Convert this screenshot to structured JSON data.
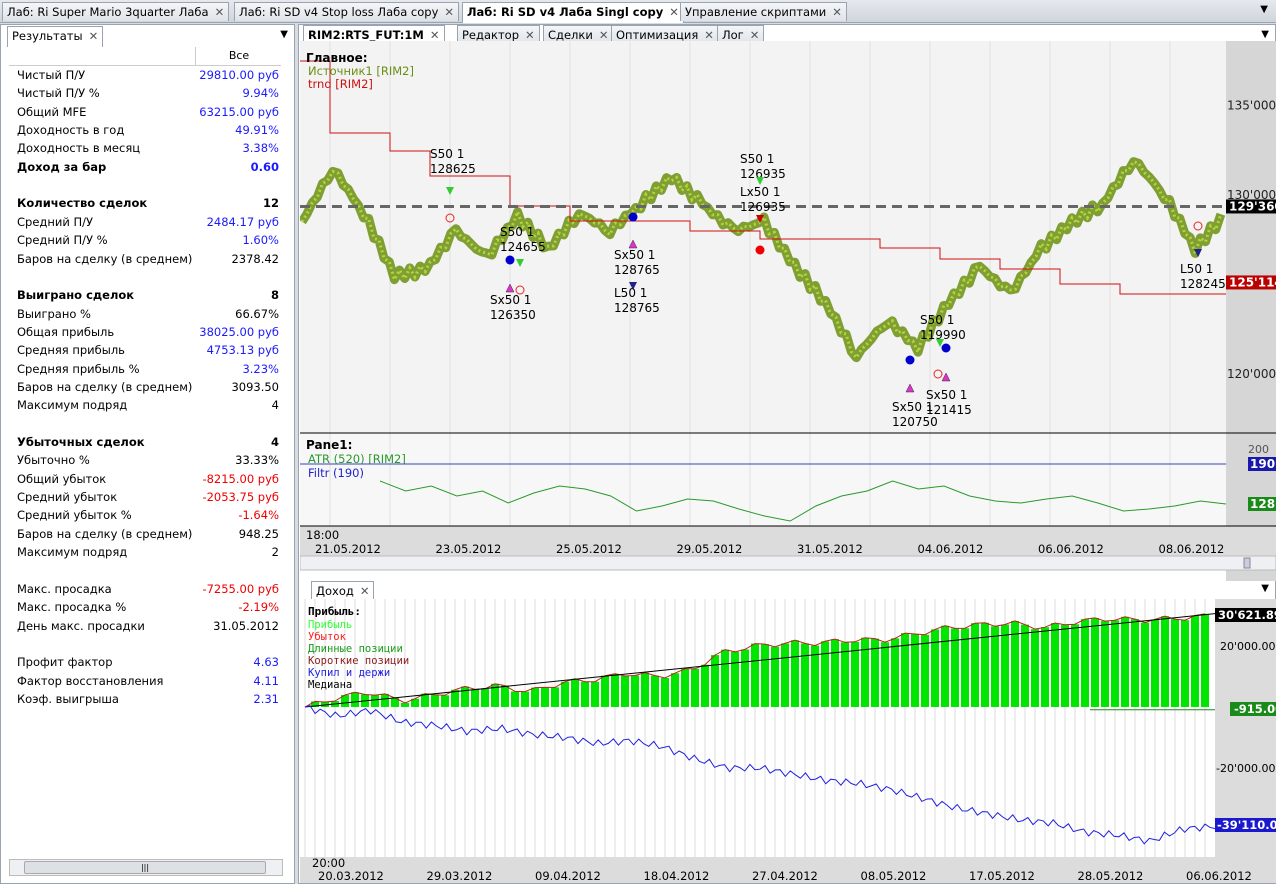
{
  "top_tabs": [
    {
      "label": "Лаб: Ri Super Mario 3quarter Лаба"
    },
    {
      "label": "Лаб: Ri SD v4 Stop loss Лаба copy"
    },
    {
      "label": "Лаб: Ri SD v4 Лаба Singl copy",
      "active": true
    },
    {
      "label": "Управление скриптами"
    }
  ],
  "left_panel": {
    "tab": "Результаты",
    "column_header": "Все",
    "rows": [
      {
        "label": "Чистый П/У",
        "value": "29810.00 руб",
        "color": "blue"
      },
      {
        "label": "Чистый П/У %",
        "value": "9.94%",
        "color": "blue"
      },
      {
        "label": "Общий MFE",
        "value": "63215.00 руб",
        "color": "blue"
      },
      {
        "label": "Доходность в год",
        "value": "49.91%",
        "color": "blue"
      },
      {
        "label": "Доходность в месяц",
        "value": "3.38%",
        "color": "blue"
      },
      {
        "label": "Доход за бар",
        "value": "0.60",
        "color": "blue",
        "bold": true
      },
      {
        "label": "",
        "value": ""
      },
      {
        "label": "Количество сделок",
        "value": "12",
        "color": "black",
        "bold": true
      },
      {
        "label": "Средний П/У",
        "value": "2484.17 руб",
        "color": "blue"
      },
      {
        "label": "Средний П/У %",
        "value": "1.60%",
        "color": "blue"
      },
      {
        "label": "Баров на сделку (в среднем)",
        "value": "2378.42",
        "color": "black"
      },
      {
        "label": "",
        "value": ""
      },
      {
        "label": "Выиграно сделок",
        "value": "8",
        "color": "black",
        "bold": true
      },
      {
        "label": "Выиграно %",
        "value": "66.67%",
        "color": "black"
      },
      {
        "label": "Общая прибыль",
        "value": "38025.00 руб",
        "color": "blue"
      },
      {
        "label": "Средняя прибыль",
        "value": "4753.13 руб",
        "color": "blue"
      },
      {
        "label": "Средняя прибыль %",
        "value": "3.23%",
        "color": "blue"
      },
      {
        "label": "Баров на сделку (в среднем)",
        "value": "3093.50",
        "color": "black"
      },
      {
        "label": "Максимум подряд",
        "value": "4",
        "color": "black"
      },
      {
        "label": "",
        "value": ""
      },
      {
        "label": "Убыточных сделок",
        "value": "4",
        "color": "black",
        "bold": true
      },
      {
        "label": "Убыточно %",
        "value": "33.33%",
        "color": "black"
      },
      {
        "label": "Общий убыток",
        "value": "-8215.00 руб",
        "color": "red"
      },
      {
        "label": "Средний убыток",
        "value": "-2053.75 руб",
        "color": "red"
      },
      {
        "label": "Средний убыток %",
        "value": "-1.64%",
        "color": "red"
      },
      {
        "label": "Баров на сделку (в среднем)",
        "value": "948.25",
        "color": "black"
      },
      {
        "label": "Максимум подряд",
        "value": "2",
        "color": "black"
      },
      {
        "label": "",
        "value": ""
      },
      {
        "label": "Макс. просадка",
        "value": "-7255.00 руб",
        "color": "red"
      },
      {
        "label": "Макс. просадка %",
        "value": "-2.19%",
        "color": "red"
      },
      {
        "label": "День макс. просадки",
        "value": "31.05.2012",
        "color": "black"
      },
      {
        "label": "",
        "value": ""
      },
      {
        "label": "Профит фактор",
        "value": "4.63",
        "color": "blue"
      },
      {
        "label": "Фактор восстановления",
        "value": "4.11",
        "color": "blue"
      },
      {
        "label": "Коэф. выигрыша",
        "value": "2.31",
        "color": "blue"
      }
    ]
  },
  "right_tabs": [
    {
      "label": "RIM2:RTS_FUT:1M",
      "active": true
    },
    {
      "label": "Редактор"
    },
    {
      "label": "Сделки"
    },
    {
      "label": "Оптимизация"
    },
    {
      "label": "Лог"
    }
  ],
  "main_chart": {
    "title": "Главное:",
    "legend": [
      "Источник1 [RIM2]",
      "trnd [RIM2]"
    ],
    "y_ticks": [
      "135'000",
      "130'000",
      "120'000"
    ],
    "last_price": "129'360",
    "trnd_last": "125'114",
    "pane1": {
      "title": "Pane1:",
      "legend": [
        "ATR (520) [RIM2]",
        "Filtr (190)"
      ],
      "tick": "200",
      "filtr_label": "190",
      "atr_label": "128"
    },
    "time_label": "18:00",
    "dates": [
      "21.05.2012",
      "23.05.2012",
      "25.05.2012",
      "29.05.2012",
      "31.05.2012",
      "04.06.2012",
      "06.06.2012",
      "08.06.2012"
    ],
    "signals": [
      {
        "l1": "S50 1",
        "l2": "128625"
      },
      {
        "l1": "S50 1",
        "l2": "124655"
      },
      {
        "l1": "Sx50 1",
        "l2": "126350"
      },
      {
        "l1": "Sx50 1",
        "l2": "128765"
      },
      {
        "l1": "L50 1",
        "l2": "128765"
      },
      {
        "l1": "S50 1",
        "l2": "126935"
      },
      {
        "l1": "Lx50 1",
        "l2": "126935"
      },
      {
        "l1": "S50 1",
        "l2": "119990"
      },
      {
        "l1": "Sx50 1",
        "l2": "121415"
      },
      {
        "l1": "Sx50 1",
        "l2": "120750"
      },
      {
        "l1": "L50 1",
        "l2": "128245"
      }
    ]
  },
  "income": {
    "tab": "Доход",
    "title": "Прибыль:",
    "legend": [
      {
        "label": "Прибыль",
        "color": "#33ff33"
      },
      {
        "label": "Убыток",
        "color": "#ff2020"
      },
      {
        "label": "Длинные позиции",
        "color": "#1a9a1a"
      },
      {
        "label": "Короткие позиции",
        "color": "#8b1a1a"
      },
      {
        "label": "Купил и держи",
        "color": "#2020e0"
      },
      {
        "label": "Медиана",
        "color": "#000000"
      }
    ],
    "y_ticks": [
      "20'000.00",
      "-20'000.00"
    ],
    "labels": {
      "profit": "30'621.89",
      "loss": "-915.00",
      "bh": "-39'110.00"
    },
    "time_label": "20:00",
    "dates": [
      "20.03.2012",
      "29.03.2012",
      "09.04.2012",
      "18.04.2012",
      "27.04.2012",
      "08.05.2012",
      "17.05.2012",
      "28.05.2012",
      "06.06.2012"
    ]
  },
  "chart_data": [
    {
      "type": "line",
      "title": "RIM2:RTS_FUT:1M",
      "series": [
        {
          "name": "Источник1 [RIM2]",
          "values": [
            128500,
            131500,
            129000,
            125500,
            125800,
            128000,
            126500,
            128800,
            127000,
            129000,
            128000,
            129500,
            131000,
            129500,
            128000,
            128500,
            126000,
            124000,
            121000,
            123000,
            121500,
            124000,
            126000,
            124500,
            127000,
            128500,
            129500,
            132000,
            130000,
            127000,
            129000
          ]
        },
        {
          "name": "trnd [RIM2]",
          "values": [
            137486,
            133464,
            132458,
            131061,
            129385,
            128547,
            127989,
            127542,
            127039,
            126425,
            125866,
            125028,
            124469
          ]
        }
      ],
      "ylim": [
        117000,
        138000
      ]
    },
    {
      "type": "area",
      "title": "Прибыль",
      "series": [
        {
          "name": "Прибыль",
          "values": [
            0,
            3000,
            5000,
            2000,
            4000,
            6000,
            7000,
            5000,
            8000,
            9000,
            11000,
            10000,
            12000,
            18000,
            20000,
            21000,
            21000,
            22000,
            22000,
            24000,
            26000,
            27000,
            27500,
            26000,
            28000,
            29000,
            28500,
            29000,
            29810
          ]
        },
        {
          "name": "Купил и держи",
          "values": [
            0,
            -3000,
            -1000,
            -5000,
            -6000,
            -8000,
            -7000,
            -9000,
            -10000,
            -12000,
            -11000,
            -13000,
            -17000,
            -20000,
            -20000,
            -22000,
            -24000,
            -25000,
            -27000,
            -30000,
            -33000,
            -35000,
            -37000,
            -38000,
            -41000,
            -42000,
            -44000,
            -40000,
            -39110
          ]
        }
      ],
      "ylim": [
        -45000,
        35000
      ]
    }
  ]
}
